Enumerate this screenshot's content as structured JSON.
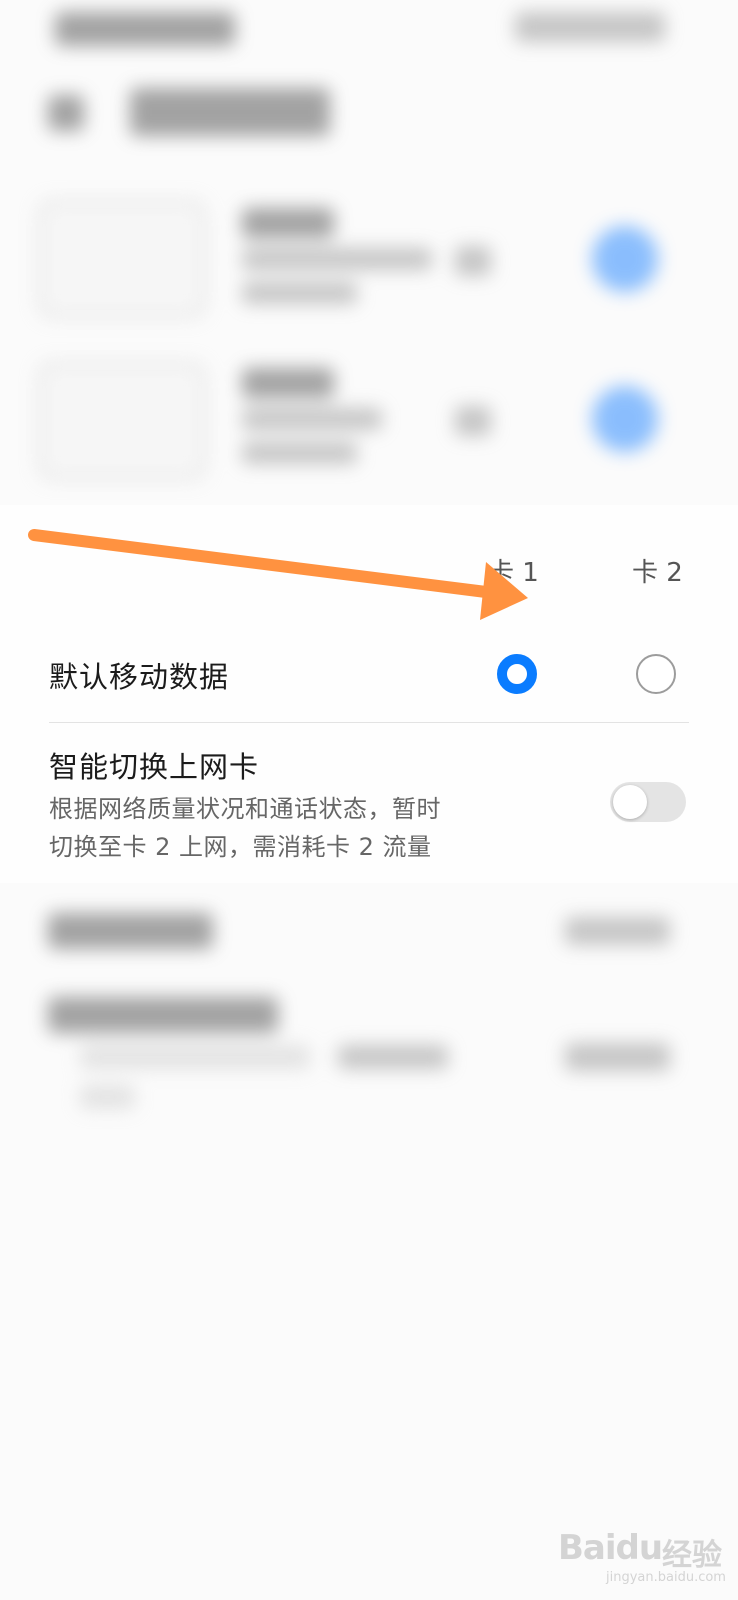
{
  "header_cards": {
    "card1": "卡 1",
    "card2": "卡 2"
  },
  "default_data": {
    "title": "默认移动数据",
    "card1_selected": true,
    "card2_selected": false
  },
  "smart_switch": {
    "title": "智能切换上网卡",
    "desc_line1": "根据网络质量状况和通话状态，暂时",
    "desc_line2": "切换至卡 2 上网，需消耗卡 2 流量",
    "enabled": false
  },
  "watermark": {
    "logo": "Baidu",
    "cn": "经验",
    "url": "jingyan.baidu.com"
  },
  "colors": {
    "accent": "#0a7cff",
    "arrow": "#ff9240"
  }
}
